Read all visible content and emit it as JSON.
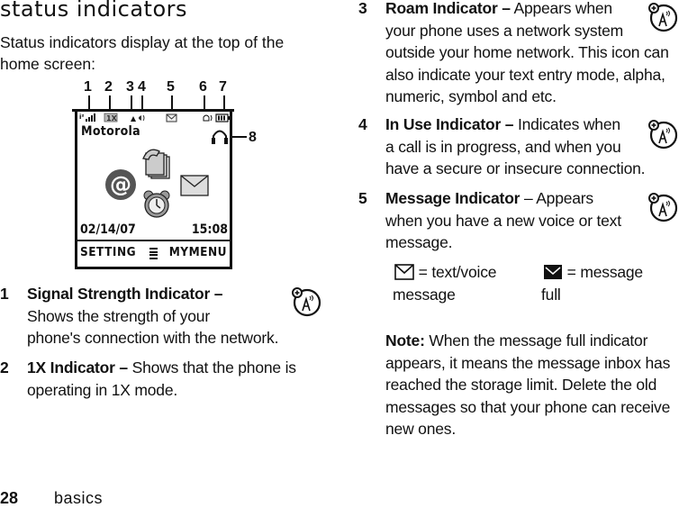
{
  "page": {
    "title": "status indicators",
    "intro": "Status indicators display at the top of the home screen:",
    "footer": {
      "page_number": "28",
      "section": "basics"
    }
  },
  "phone_screen": {
    "callouts": [
      "1",
      "2",
      "3",
      "4",
      "5",
      "6",
      "7",
      "8"
    ],
    "brand": "Motorola",
    "date": "02/14/07",
    "time": "15:08",
    "soft_left": "SETTING",
    "soft_right": "MYMENU",
    "status_icons": [
      "signal-strength-icon",
      "1x-icon",
      "roam-icon",
      "in-use-icon",
      "message-icon",
      "ring-style-icon",
      "battery-icon",
      "headset-icon"
    ],
    "labels": {
      "onex": "1X"
    },
    "home_icons": [
      "email-at-icon",
      "phonebook-icon",
      "message-envelope-icon",
      "alarm-clock-icon"
    ]
  },
  "indicators": [
    {
      "num": "1",
      "name": "Signal Strength Indicator –",
      "desc_lines": [
        "Shows the strength of your",
        "phone's connection with the network."
      ]
    },
    {
      "num": "2",
      "name": "1X Indicator –",
      "desc_lines": [
        " Shows that the phone is",
        "operating in 1X mode."
      ]
    },
    {
      "num": "3",
      "name": "Roam Indicator –",
      "desc_lines": [
        " Appears when",
        "your phone uses a network system",
        "outside your home network. This icon can",
        "also indicate your text entry mode, alpha,",
        "numeric, symbol and etc."
      ]
    },
    {
      "num": "4",
      "name": "In Use Indicator –",
      "desc_lines": [
        " Indicates when",
        "a call is in progress, and when you",
        "have a secure or insecure connection."
      ]
    },
    {
      "num": "5",
      "name": "Message Indicator",
      "desc_lines": [
        " – Appears",
        "when you have a new voice or text",
        "message."
      ]
    }
  ],
  "message_legend": [
    {
      "icon": "envelope-outline-icon",
      "text1": "= text/voice",
      "text2": "message"
    },
    {
      "icon": "envelope-filled-icon",
      "text1": "= message",
      "text2": "full"
    }
  ],
  "note": {
    "label": "Note:",
    "text_lines": [
      " When the message full indicator",
      "appears, it means the message inbox has",
      "reached the storage limit. Delete the old",
      "messages so that your phone can receive",
      "new ones."
    ]
  }
}
